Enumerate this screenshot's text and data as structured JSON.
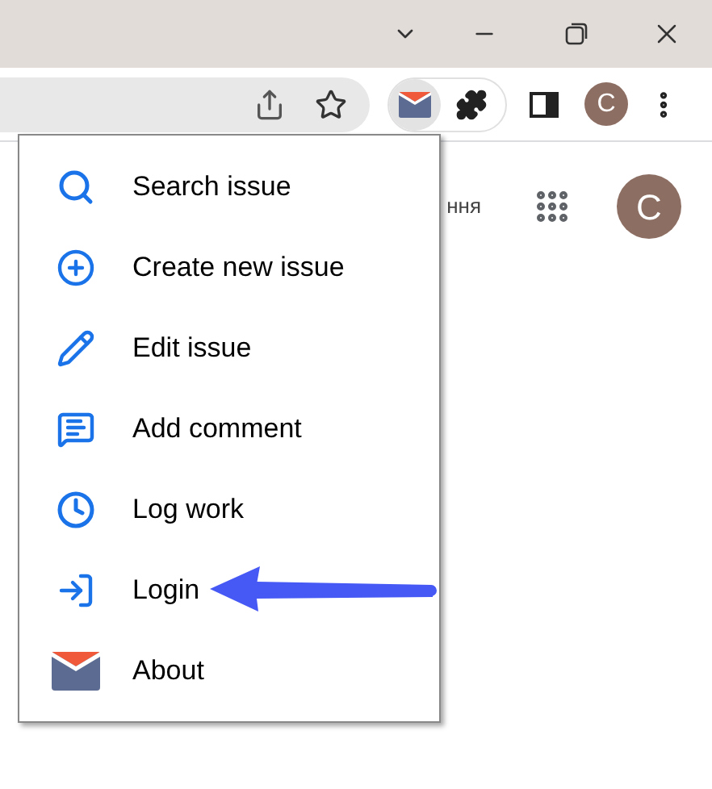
{
  "browser": {
    "profile_initial": "C",
    "extension_active": true
  },
  "page": {
    "partial_text": "ння",
    "avatar_initial": "C"
  },
  "menu": {
    "items": [
      {
        "label": "Search issue"
      },
      {
        "label": "Create new issue"
      },
      {
        "label": "Edit issue"
      },
      {
        "label": "Add comment"
      },
      {
        "label": "Log work"
      },
      {
        "label": "Login"
      },
      {
        "label": "About"
      }
    ]
  }
}
